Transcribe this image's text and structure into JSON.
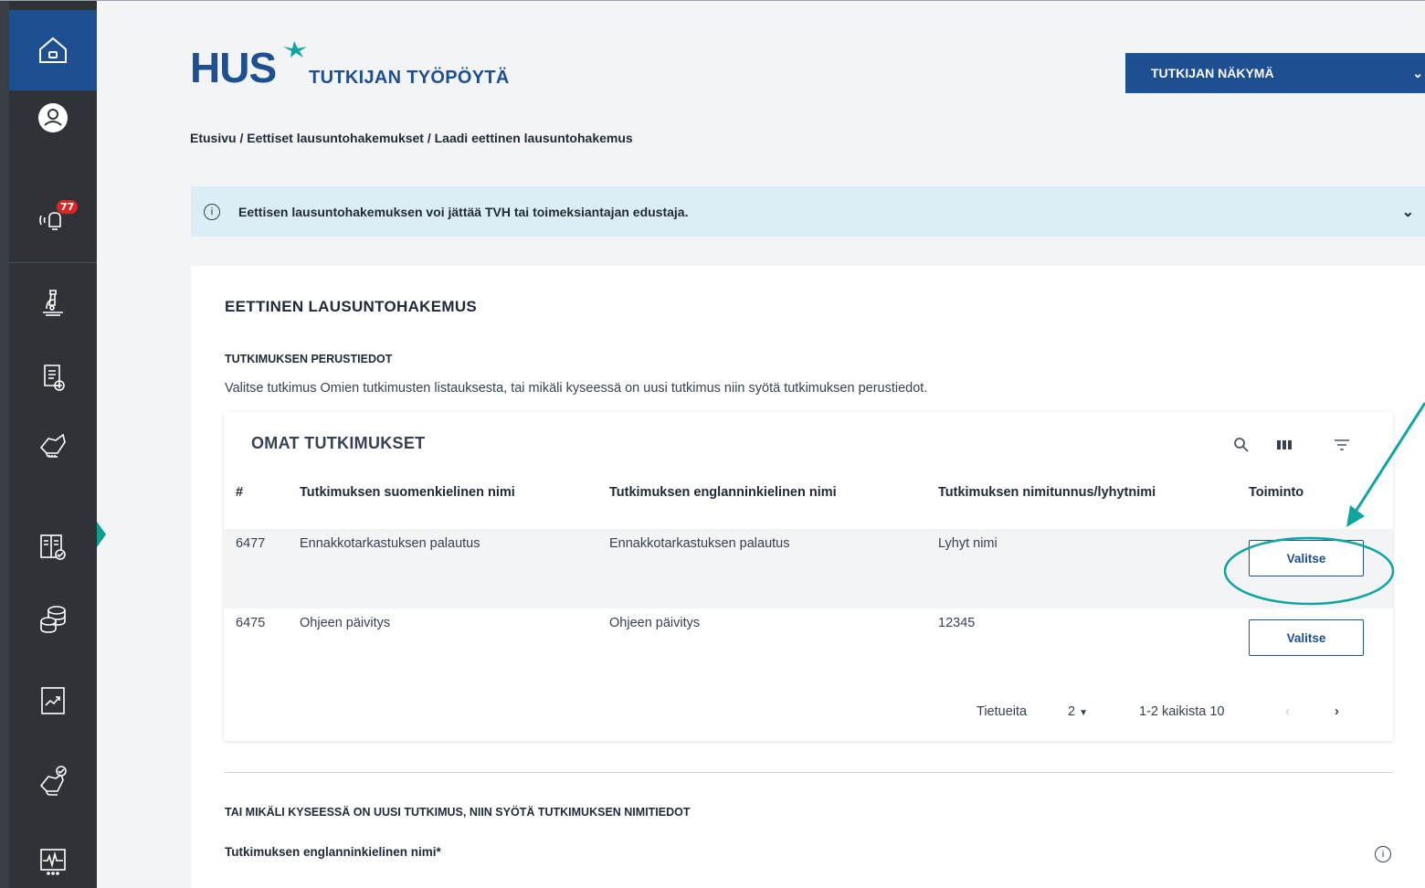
{
  "sidebar": {
    "notification_count": "77",
    "items": [
      {
        "icon": "home-icon"
      },
      {
        "icon": "user-icon"
      },
      {
        "icon": "notification-icon"
      },
      {
        "icon": "microscope-icon"
      },
      {
        "icon": "document-add-icon"
      },
      {
        "icon": "handshake-icon"
      },
      {
        "icon": "checklist-icon"
      },
      {
        "icon": "coins-icon"
      },
      {
        "icon": "chart-icon"
      },
      {
        "icon": "handshake-check-icon"
      },
      {
        "icon": "monitor-icon"
      }
    ]
  },
  "header": {
    "logo_text": "HUS",
    "app_title": "TUTKIJAN TYÖPÖYTÄ",
    "view_select": "TUTKIJAN NÄKYMÄ"
  },
  "breadcrumb": "Etusivu / Eettiset lausuntohakemukset / Laadi eettinen lausuntohakemus",
  "info_banner": "Eettisen lausuntohakemuksen voi jättää TVH tai toimeksiantajan edustaja.",
  "form": {
    "title": "EETTINEN LAUSUNTOHAKEMUS",
    "section_title": "TUTKIMUKSEN PERUSTIEDOT",
    "section_desc": "Valitse tutkimus Omien tutkimusten listauksesta, tai mikäli kyseessä on uusi tutkimus niin syötä tutkimuksen perustiedot.",
    "table": {
      "title": "OMAT TUTKIMUKSET",
      "columns": [
        "#",
        "Tutkimuksen suomenkielinen nimi",
        "Tutkimuksen englanninkielinen nimi",
        "Tutkimuksen nimitunnus/lyhytnimi",
        "Toiminto"
      ],
      "rows": [
        {
          "id": "6477",
          "fi_name": "Ennakkotarkastuksen palautus",
          "en_name": "Ennakkotarkastuksen palautus",
          "short": "Lyhyt nimi",
          "action": "Valitse"
        },
        {
          "id": "6475",
          "fi_name": "Ohjeen päivitys",
          "en_name": "Ohjeen päivitys",
          "short": "12345",
          "action": "Valitse"
        }
      ],
      "pager": {
        "rows_label": "Tietueita",
        "rows_value": "2",
        "range": "1-2 kaikista 10"
      }
    },
    "section2_title": "TAI MIKÄLI KYSEESSÄ ON UUSI TUTKIMUS, NIIN SYÖTÄ TUTKIMUKSEN NIMITIEDOT",
    "field_label": "Tutkimuksen englanninkielinen nimi*"
  },
  "colors": {
    "brand": "#1d4f91",
    "sidebar": "#2f3338",
    "annotation": "#0fa5a0"
  }
}
